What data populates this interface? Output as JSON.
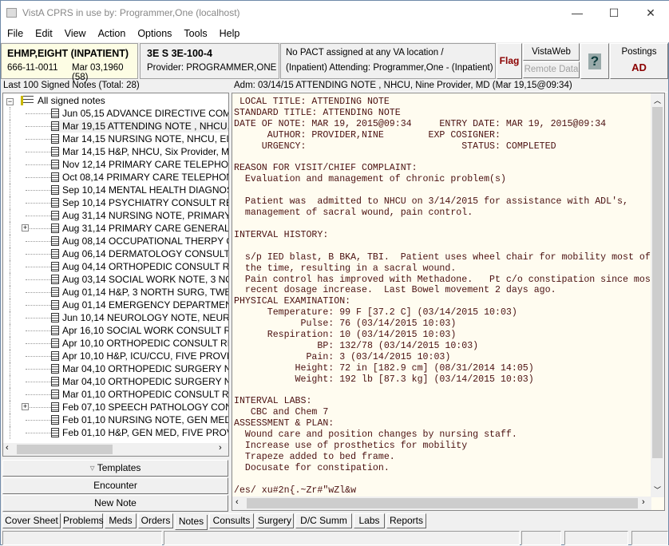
{
  "window": {
    "title": "VistA CPRS in use by: Programmer,One  (localhost)",
    "minimize": "—",
    "maximize": "☐",
    "close": "✕"
  },
  "menu": [
    "File",
    "Edit",
    "View",
    "Action",
    "Options",
    "Tools",
    "Help"
  ],
  "patient": {
    "name": "EHMP,EIGHT (INPATIENT)",
    "ssn": "666-11-0011",
    "dob": "Mar 03,1960 (58)"
  },
  "location": {
    "room": "3E S 3E-100-4",
    "provider": "Provider:  PROGRAMMER,ONE"
  },
  "pact": {
    "line1": "No PACT assigned at any VA location /",
    "line2": "(Inpatient) Attending:  Programmer,One - (Inpatient) Provi"
  },
  "buttons": {
    "flag": "Flag",
    "vistaweb": "VistaWeb",
    "remote_data": "Remote Data",
    "help": "?",
    "postings": "Postings",
    "postings_value": "AD",
    "templates": "Templates",
    "encounter": "Encounter",
    "new_note": "New Note"
  },
  "colors": {
    "patient_bg": "#fdfde4",
    "flag": "#8b0000",
    "note_bg": "#fffcf0",
    "note_text": "#4a1010"
  },
  "tree": {
    "label": "Last 100 Signed Notes (Total: 28)",
    "root": "All signed notes",
    "items": [
      {
        "text": "Jun 05,15  ADVANCE DIRECTIVE COMPL",
        "expandable": false
      },
      {
        "text": "Mar 19,15  ATTENDING NOTE  , NHCU, N",
        "expandable": false,
        "selected": true
      },
      {
        "text": "Mar 14,15  NURSING NOTE, NHCU, EIGH",
        "expandable": false
      },
      {
        "text": "Mar 14,15  H&P, NHCU, Six Provider, MD",
        "expandable": false
      },
      {
        "text": "Nov 12,14  PRIMARY CARE TELEPHONE",
        "expandable": false
      },
      {
        "text": "Oct 08,14  PRIMARY CARE TELEPHONE,",
        "expandable": false
      },
      {
        "text": "Sep 10,14  MENTAL HEALTH DIAGNOST",
        "expandable": false
      },
      {
        "text": "Sep 10,14  PSYCHIATRY CONSULT REPO",
        "expandable": false
      },
      {
        "text": "Aug 31,14  NURSING NOTE, PRIMARY CA",
        "expandable": false
      },
      {
        "text": "Aug 31,14  PRIMARY CARE GENERAL NO",
        "expandable": true
      },
      {
        "text": "Aug 08,14  OCCUPATIONAL THERPY COI",
        "expandable": false
      },
      {
        "text": "Aug 06,14  DERMATOLOGY CONSULT RI",
        "expandable": false
      },
      {
        "text": "Aug 04,14  ORTHOPEDIC CONSULT REP",
        "expandable": false
      },
      {
        "text": "Aug 03,14  SOCIAL WORK NOTE, 3 NORT",
        "expandable": false
      },
      {
        "text": "Aug 01,14  H&P, 3 NORTH SURG, TWENT",
        "expandable": false
      },
      {
        "text": "Aug 01,14  EMERGENCY DEPARTMENT",
        "expandable": false
      },
      {
        "text": "Jun 10,14  NEUROLOGY NOTE, NEUROL",
        "expandable": false
      },
      {
        "text": "Apr 16,10  SOCIAL WORK CONSULT REF",
        "expandable": false
      },
      {
        "text": "Apr 10,10  ORTHOPEDIC CONSULT REPO",
        "expandable": false
      },
      {
        "text": "Apr 10,10  H&P, ICU/CCU, FIVE PROVIDE",
        "expandable": false
      },
      {
        "text": "Mar 04,10  ORTHOPEDIC SURGERY NOT",
        "expandable": false
      },
      {
        "text": "Mar 04,10  ORTHOPEDIC SURGERY NOT",
        "expandable": false
      },
      {
        "text": "Mar 01,10  ORTHOPEDIC CONSULT REP",
        "expandable": false
      },
      {
        "text": "Feb 07,10  SPEECH PATHOLOGY CONSU",
        "expandable": true
      },
      {
        "text": "Feb 01,10  NURSING NOTE, GEN MED, E",
        "expandable": false
      },
      {
        "text": "Feb 01,10  H&P, GEN MED, FIVE PROVID",
        "expandable": false
      }
    ]
  },
  "note": {
    "header": "Adm: 03/14/15  ATTENDING NOTE  , NHCU, Nine Provider, MD  (Mar 19,15@09:34)",
    "text": " LOCAL TITLE: ATTENDING NOTE\nSTANDARD TITLE: ATTENDING NOTE\nDATE OF NOTE: MAR 19, 2015@09:34     ENTRY DATE: MAR 19, 2015@09:34\n      AUTHOR: PROVIDER,NINE        EXP COSIGNER: \n     URGENCY:                            STATUS: COMPLETED\n\nREASON FOR VISIT/CHIEF COMPLAINT:\n  Evaluation and management of chronic problem(s)\n\n  Patient was  admitted to NHCU on 3/14/2015 for assistance with ADL's,\n  management of sacral wound, pain control.\n\nINTERVAL HISTORY:\n\n  s/p IED blast, B BKA, TBI.  Patient uses wheel chair for mobility most of\n  the time, resulting in a sacral wound.\n  Pain control has improved with Methadone.   Pt c/o constipation since mos\n  recent dosage increase.  Last Bowel movement 2 days ago.\nPHYSICAL EXAMINATION:\n      Temperature: 99 F [37.2 C] (03/14/2015 10:03)\n            Pulse: 76 (03/14/2015 10:03)\n      Respiration: 10 (03/14/2015 10:03)\n               BP: 132/78 (03/14/2015 10:03)\n             Pain: 3 (03/14/2015 10:03)\n           Height: 72 in [182.9 cm] (08/31/2014 14:05)\n           Weight: 192 lb [87.3 kg] (03/14/2015 10:03)\n\nINTERVAL LABS:\n   CBC and Chem 7\nASSESSMENT & PLAN:\n  Wound care and position changes by nursing staff.\n  Increase use of prosthetics for mobility\n  Trapeze added to bed frame.\n  Docusate for constipation.\n\n/es/ xu#2n{.~Zr#\"wZl&w"
  },
  "tabs": [
    "Cover Sheet",
    "Problems",
    "Meds",
    "Orders",
    "Notes",
    "Consults",
    "Surgery",
    "D/C Summ",
    "Labs",
    "Reports"
  ],
  "active_tab": "Notes"
}
